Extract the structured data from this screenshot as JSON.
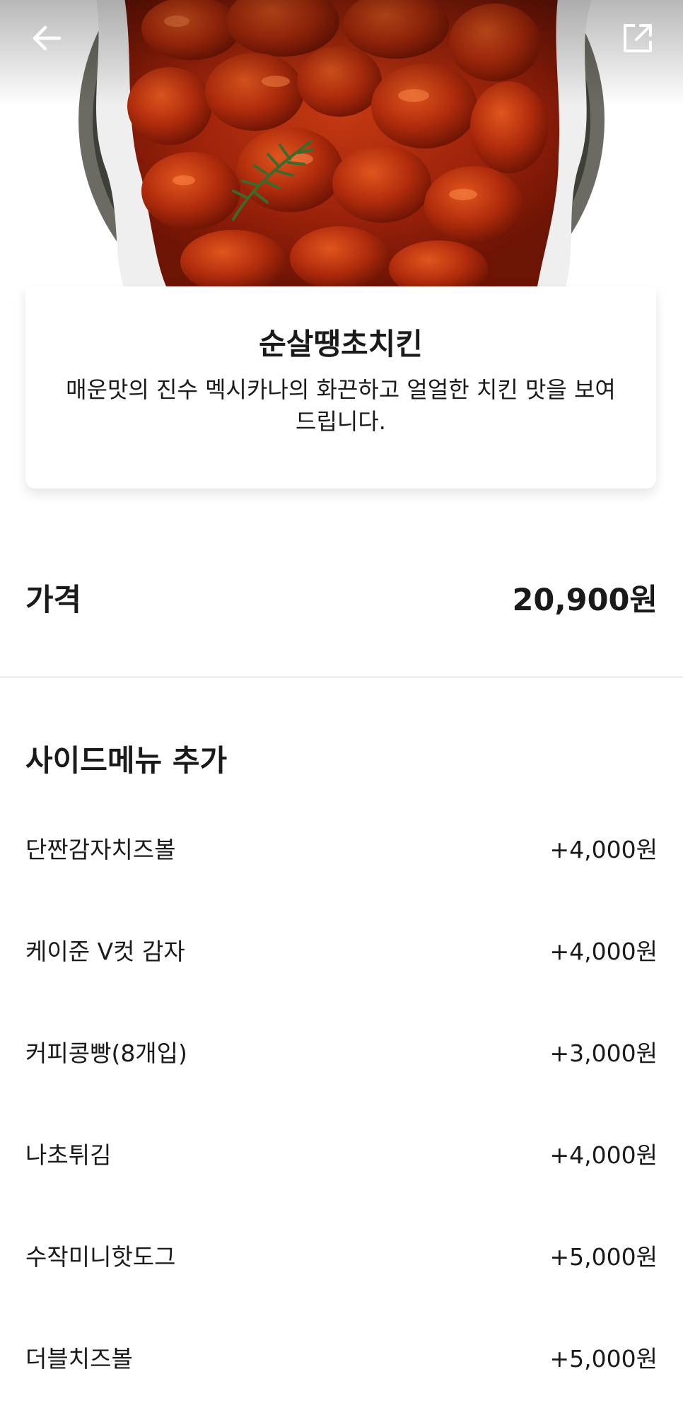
{
  "header": {
    "back_icon": "arrow-left-icon",
    "share_icon": "share-external-icon"
  },
  "menu": {
    "title": "순살땡초치킨",
    "description": "매운맛의 진수 멕시카나의 화끈하고 얼얼한 치킨 맛을 보여드립니다."
  },
  "price": {
    "label": "가격",
    "value": "20,900원"
  },
  "side_menu": {
    "title": "사이드메뉴 추가",
    "items": [
      {
        "name": "단짠감자치즈볼",
        "price": "+4,000원"
      },
      {
        "name": "케이준 V컷 감자",
        "price": "+4,000원"
      },
      {
        "name": "커피콩빵(8개입)",
        "price": "+3,000원"
      },
      {
        "name": "나초튀김",
        "price": "+4,000원"
      },
      {
        "name": "수작미니핫도그",
        "price": "+5,000원"
      },
      {
        "name": "더블치즈볼",
        "price": "+5,000원"
      }
    ]
  }
}
